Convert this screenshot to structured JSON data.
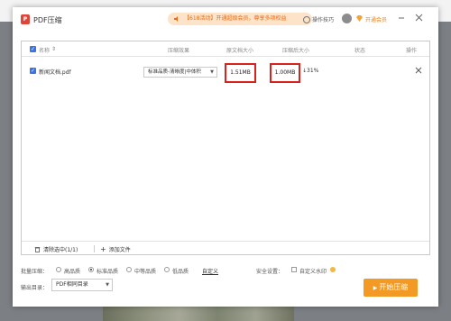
{
  "app": {
    "title": "PDF压缩",
    "logo_text": "P"
  },
  "notice": {
    "text": "【618活动】开通超级会员，尊享多项权益"
  },
  "header_links": {
    "tips": "操作技巧",
    "vip": "开通会员"
  },
  "table": {
    "columns": [
      "名称",
      "压缩效果",
      "原文档大小",
      "压缩后大小",
      "状态",
      "操作"
    ],
    "rows": [
      {
        "name": "新闻文档.pdf",
        "mode": "标准品质-清晰度|中体积",
        "original_size": "1.51MB",
        "compressed_size": "1.00MB",
        "reduction": "↓31%"
      }
    ]
  },
  "footer": {
    "clear": "清除选中(1/1)",
    "add": "添加文件"
  },
  "options": {
    "batch_label": "批量压缩：",
    "qualities": [
      "高品质",
      "标准品质",
      "中等品质",
      "低品质"
    ],
    "selected_quality": "标准品质",
    "custom": "自定义",
    "security_label": "安全设置：",
    "watermark": "自定义水印"
  },
  "output": {
    "label": "输出目录：",
    "value": "PDF相同目录"
  },
  "start_button": "开始压缩",
  "colors": {
    "accent": "#f39a24",
    "highlight_border": "#d9221c",
    "checkbox": "#3b74e0"
  }
}
